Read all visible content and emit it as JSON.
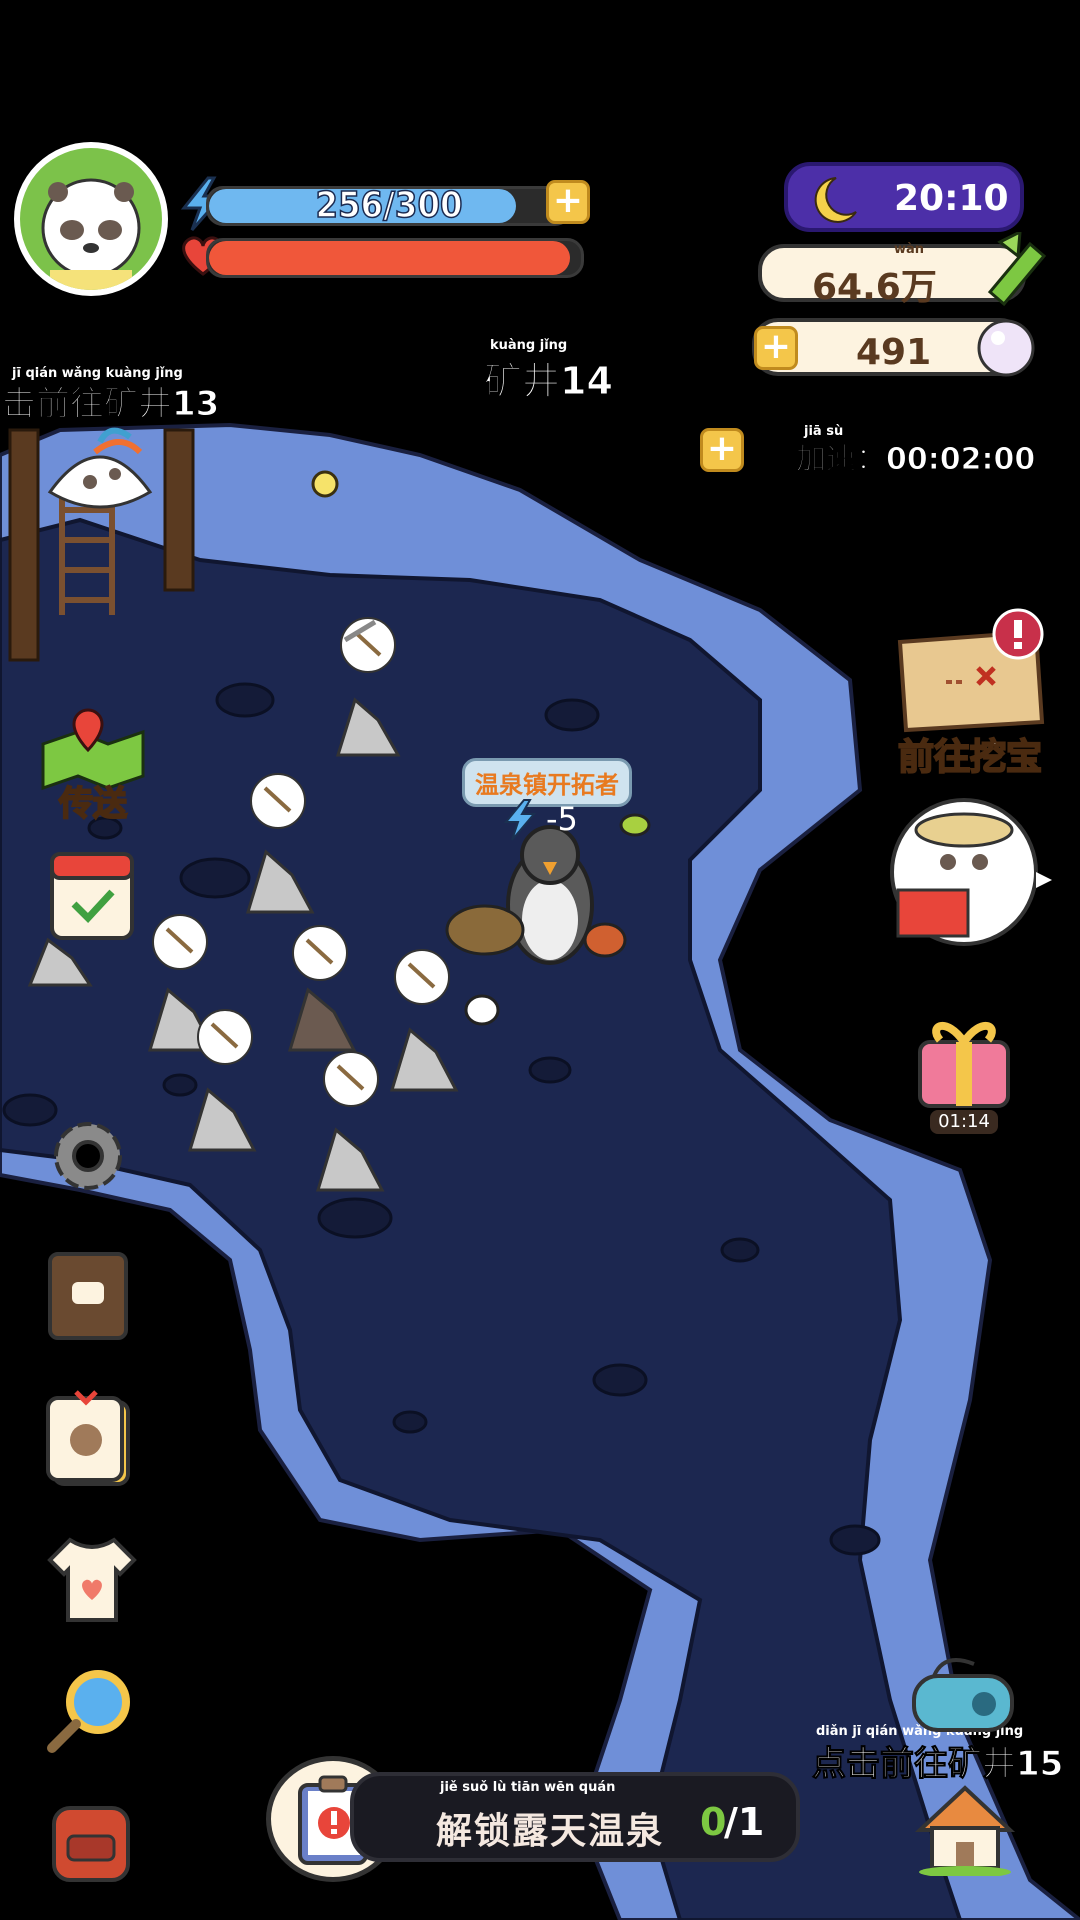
{
  "hud": {
    "energy_text": "256/300",
    "energy_fraction": 0.853,
    "health_fraction": 0.97,
    "time": "20:10",
    "coins": "64.6万",
    "coins_pinyin": "wàn",
    "pearls": "491",
    "speedup_label": "加速：00:02:00",
    "speedup_pinyin": "jiā  sù"
  },
  "map": {
    "current_mine": "矿井14",
    "current_mine_pinyin": "kuàng  jǐng",
    "left_nav_text": "击前往矿井13",
    "left_nav_pinyin": "jī   qián wǎng kuàng  jǐng",
    "right_nav_text": "点击前往矿井15",
    "right_nav_pinyin": "diǎn  jī   qián wǎng kuàng  jǐng",
    "player_title": "温泉镇开拓者",
    "energy_cost": "-5"
  },
  "buttons": {
    "teleport": "传送",
    "treasure": "前往挖宝",
    "gift_timer": "01:14"
  },
  "task": {
    "text": "解锁露天温泉",
    "pinyin": "jiě  suǒ   lù   tiān  wēn  quán",
    "progress_done": "0",
    "progress_total": "/1"
  },
  "colors": {
    "cave_floor": "#1c2750",
    "cave_wall": "#6f8fd8",
    "energy": "#6fb8f0",
    "health": "#f0573a",
    "accent_gold": "#f4c64a",
    "night_pill": "#4c2fa8"
  }
}
